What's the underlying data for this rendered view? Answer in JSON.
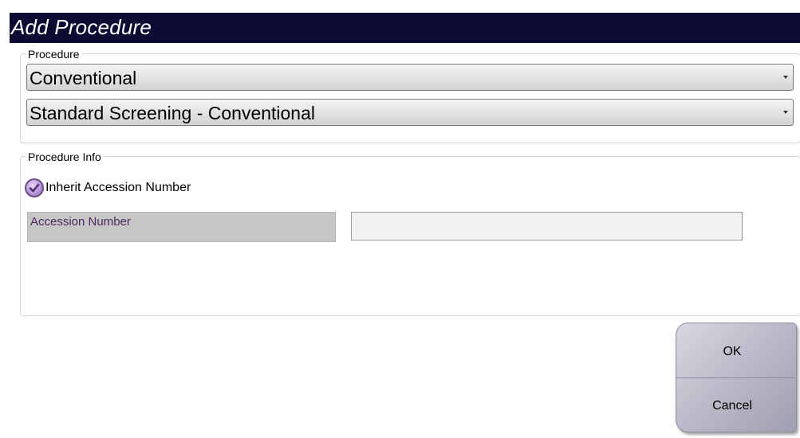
{
  "dialog": {
    "title": "Add Procedure"
  },
  "procedure_group": {
    "legend": "Procedure",
    "type_select": {
      "value": "Conventional"
    },
    "procedure_select": {
      "value": "Standard Screening - Conventional"
    }
  },
  "info_group": {
    "legend": "Procedure Info",
    "inherit_checkbox": {
      "label": "Inherit Accession Number",
      "checked": true
    },
    "accession": {
      "label": "Accession Number",
      "value": ""
    }
  },
  "buttons": {
    "ok_label": "OK",
    "cancel_label": "Cancel"
  },
  "colors": {
    "title_bar": "#0b0b33",
    "title_text": "#ffffff",
    "checkbox_fill": "#b38fd6",
    "accession_label_bg": "#c6c6c6",
    "accession_label_text": "#4a2a5e",
    "button_face": "#b9b9c7"
  },
  "icons": {
    "select_arrow": "chevron-down-icon",
    "checkbox_mark": "checkmark-icon"
  }
}
